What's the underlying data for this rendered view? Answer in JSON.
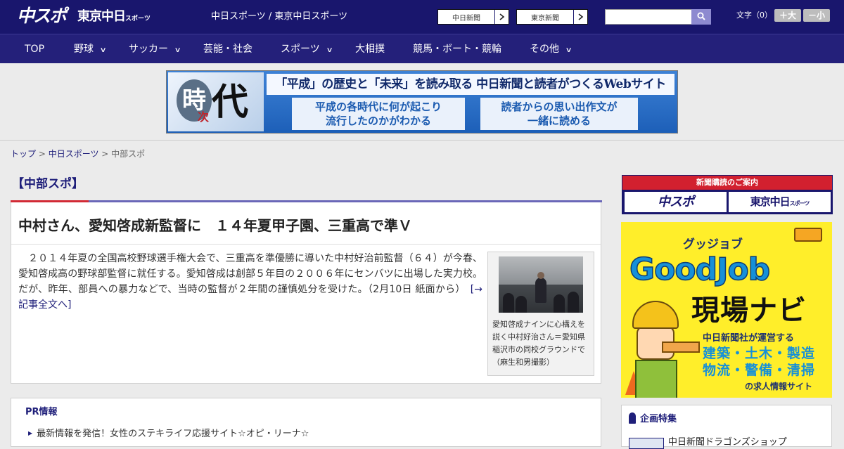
{
  "header": {
    "logo_chuspo": "中スポ",
    "logo_tokyo": "東京中日",
    "logo_tokyo_small": "スポーツ",
    "site_links": "中日スポーツ / 東京中日スポーツ",
    "paper_chunichi": "中日新聞",
    "paper_tokyo": "東京新聞",
    "search": {
      "placeholder": "",
      "value": ""
    },
    "font_size_label": "文字（0）",
    "font_larger": "＋大",
    "font_smaller": "－小"
  },
  "nav": {
    "items": [
      {
        "label": "TOP",
        "has_menu": false
      },
      {
        "label": "野球",
        "has_menu": true
      },
      {
        "label": "サッカー",
        "has_menu": true
      },
      {
        "label": "芸能・社会",
        "has_menu": false
      },
      {
        "label": "スポーツ",
        "has_menu": true
      },
      {
        "label": "大相撲",
        "has_menu": false
      },
      {
        "label": "競馬・ボート・競輪",
        "has_menu": false
      },
      {
        "label": "その他",
        "has_menu": true
      }
    ],
    "chevron": "∨"
  },
  "banner": {
    "ji": "時",
    "tsugi": "次",
    "dai": "代",
    "headline": "「平成」の歴史と「未来」を読み取る 中日新聞と読者がつくるWebサイト",
    "left_line1": "平成の各時代に何が起こり",
    "left_line2": "流行したのかがわかる",
    "right_line1": "読者からの思い出作文が",
    "right_line2": "一緒に読める"
  },
  "breadcrumb": {
    "home": "トップ",
    "sep1": " > ",
    "section": "中日スポーツ",
    "sep2": " > ",
    "current": "中部スポ"
  },
  "main": {
    "category_title": "【中部スポ】",
    "article": {
      "headline": "中村さん、愛知啓成新監督に　１４年夏甲子園、三重高で準Ｖ",
      "body": "　２０１４年夏の全国高校野球選手権大会で、三重高を準優勝に導いた中村好治前監督（６４）が今春、愛知啓成高の野球部監督に就任する。愛知啓成は創部５年目の２００６年にセンバツに出場した実力校。だが、昨年、部員への暴力などで、当時の監督が２年間の謹慎処分を受けた。（2月10日 紙面から）　",
      "more_link": "[→記事全文へ]",
      "photo_caption": "愛知啓成ナインに心構えを説く中村好治さん＝愛知県稲沢市の同校グラウンドで（麻生和男撮影）"
    },
    "pr": {
      "title": "PR情報",
      "items": [
        "最新情報を発信！女性のステキライフ応援サイト☆オピ・リーナ☆"
      ]
    }
  },
  "sidebar": {
    "subscribe_title": "新聞購読のご案内",
    "subscribe_left": "中スポ",
    "subscribe_right": "東京中日",
    "subscribe_right_small": "スポーツ",
    "goodjob": {
      "ruby": "グッジョブ",
      "logo": "GoodJob",
      "navi": "現場ナビ",
      "line1": "中日新聞社が運営する",
      "line2": "建築・土木・製造",
      "line3": "物流・警備・清掃",
      "line4": "の求人情報サイト"
    },
    "features": {
      "title": "企画特集",
      "first_item": "中日新聞ドラゴンズショップ"
    }
  },
  "colors": {
    "header_bg": "#19166d",
    "nav_bg": "#24207a",
    "accent_red": "#d22a35",
    "accent_blue": "#6a67b8",
    "link": "#1f1f7a",
    "ad_yellow": "#ffee2a"
  },
  "icons": {
    "search": "search-icon",
    "paper_arrow": "chevron-right-icon",
    "nav_chevron": "chevron-down-icon",
    "pr_bullet": "triangle-right-icon",
    "features": "pin-icon"
  }
}
